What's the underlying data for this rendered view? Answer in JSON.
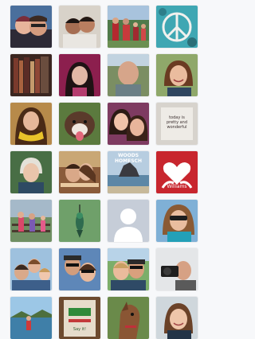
{
  "grid": {
    "columns": 4,
    "rows": 7,
    "tiles": [
      {
        "row": 1,
        "col": 1,
        "kind": "couple-selfie"
      },
      {
        "row": 1,
        "col": 2,
        "kind": "kids-hug"
      },
      {
        "row": 1,
        "col": 3,
        "kind": "family-outdoor"
      },
      {
        "row": 1,
        "col": 4,
        "kind": "peace-sign-art"
      },
      {
        "row": 2,
        "col": 1,
        "kind": "books-shelf"
      },
      {
        "row": 2,
        "col": 2,
        "kind": "woman-dark-hair"
      },
      {
        "row": 2,
        "col": 3,
        "kind": "man-outdoors"
      },
      {
        "row": 2,
        "col": 4,
        "kind": "woman-smile"
      },
      {
        "row": 3,
        "col": 1,
        "kind": "woman-yellow-scarf"
      },
      {
        "row": 3,
        "col": 2,
        "kind": "dog-tongue"
      },
      {
        "row": 3,
        "col": 3,
        "kind": "two-girls"
      },
      {
        "row": 3,
        "col": 4,
        "kind": "text-card"
      },
      {
        "row": 4,
        "col": 1,
        "kind": "older-woman"
      },
      {
        "row": 4,
        "col": 2,
        "kind": "couple-kiss"
      },
      {
        "row": 4,
        "col": 3,
        "kind": "coast-rock",
        "caption": "WOODS HOMESCH"
      },
      {
        "row": 4,
        "col": 4,
        "kind": "heart-hands",
        "caption": "Williams"
      },
      {
        "row": 5,
        "col": 1,
        "kind": "kids-on-fence"
      },
      {
        "row": 5,
        "col": 2,
        "kind": "hummingbird"
      },
      {
        "row": 5,
        "col": 3,
        "kind": "default-avatar"
      },
      {
        "row": 5,
        "col": 4,
        "kind": "woman-sunglasses"
      },
      {
        "row": 6,
        "col": 1,
        "kind": "family-group"
      },
      {
        "row": 6,
        "col": 2,
        "kind": "couple-sunglasses"
      },
      {
        "row": 6,
        "col": 3,
        "kind": "couple-hat"
      },
      {
        "row": 6,
        "col": 4,
        "kind": "photographer"
      },
      {
        "row": 7,
        "col": 1,
        "kind": "lake-child"
      },
      {
        "row": 7,
        "col": 2,
        "kind": "poster-green"
      },
      {
        "row": 7,
        "col": 3,
        "kind": "horse"
      },
      {
        "row": 7,
        "col": 4,
        "kind": "woman-portrait"
      }
    ],
    "captions": {
      "t43": "WOODS HOMESCH",
      "t44": "Williams",
      "t34": "today is pretty and wonderful",
      "t72": "Say it!"
    }
  },
  "colors": {
    "background": "#f7f8fa",
    "avatar_bg": "#c6cdd8",
    "avatar_fg": "#ffffff"
  }
}
